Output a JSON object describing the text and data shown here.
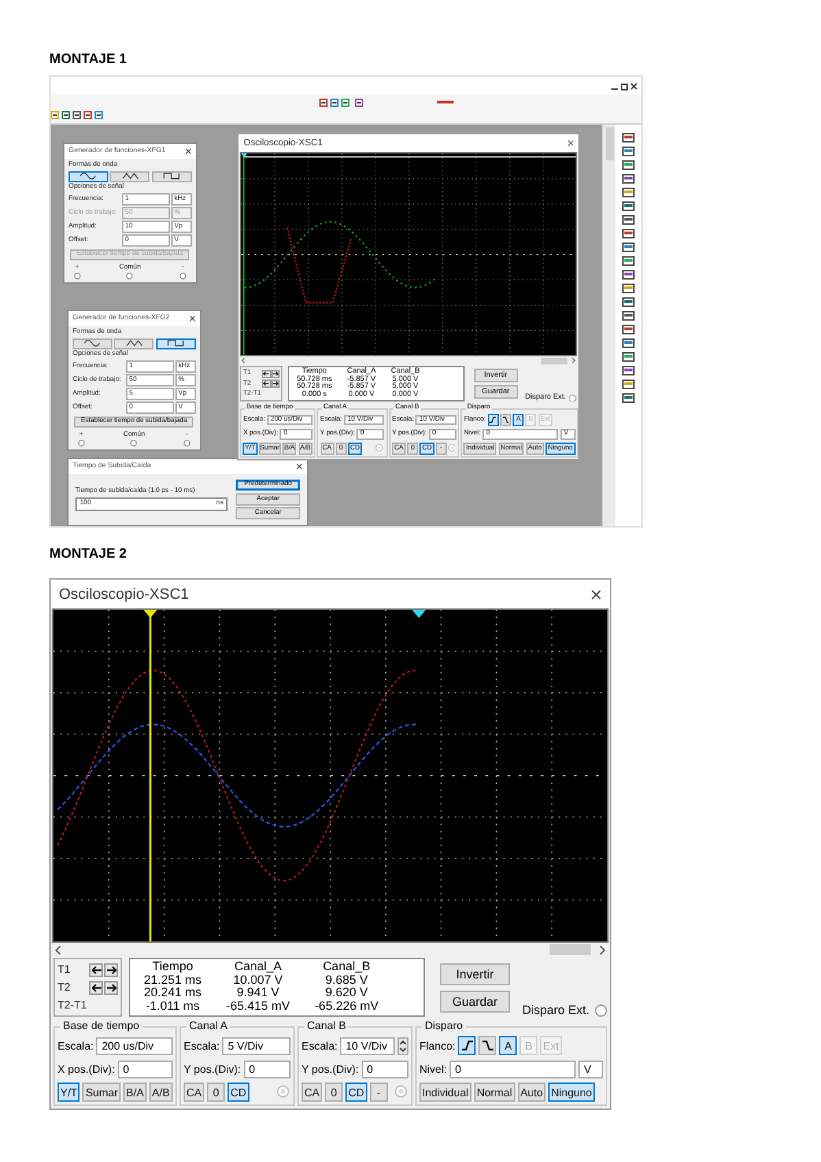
{
  "montaje_1": {
    "heading": "MONTAJE 1",
    "windows": [
      {
        "kind": "function_generator",
        "title": "Generador de funciones-XFG1",
        "waveform_label": "Formas de onda",
        "waveforms": [
          {
            "kind": "sine",
            "selected": true
          },
          {
            "kind": "triangle",
            "selected": false
          },
          {
            "kind": "square",
            "selected": false
          }
        ],
        "options_label": "Opciones de señal",
        "params": [
          {
            "label": "Frecuencia:",
            "value": "1",
            "unit": "kHz",
            "disabled": false
          },
          {
            "label": "Ciclo de trabajo:",
            "value": "50",
            "unit": "%",
            "disabled": true
          },
          {
            "label": "Amplitud:",
            "value": "10",
            "unit": "Vp",
            "disabled": false
          },
          {
            "label": "Offset:",
            "value": "0",
            "unit": "V",
            "disabled": false
          }
        ],
        "rise_button": {
          "label": "Establecer tiempo de subida/bajada",
          "disabled": true
        },
        "terminals": [
          "+",
          "Común",
          "-"
        ]
      },
      {
        "kind": "function_generator",
        "title": "Generador de funciones-XFG2",
        "waveform_label": "Formas de onda",
        "waveforms": [
          {
            "kind": "sine",
            "selected": false
          },
          {
            "kind": "triangle",
            "selected": false
          },
          {
            "kind": "square",
            "selected": true
          }
        ],
        "options_label": "Opciones de señal",
        "params": [
          {
            "label": "Frecuencia:",
            "value": "1",
            "unit": "kHz",
            "disabled": false
          },
          {
            "label": "Ciclo de trabajo:",
            "value": "50",
            "unit": "%",
            "disabled": false
          },
          {
            "label": "Amplitud:",
            "value": "5",
            "unit": "Vp",
            "disabled": false
          },
          {
            "label": "Offset:",
            "value": "0",
            "unit": "V",
            "disabled": false
          }
        ],
        "rise_button": {
          "label": "Establecer tiempo de subida/bajada",
          "disabled": false
        },
        "terminals": [
          "+",
          "Común",
          "-"
        ]
      },
      {
        "kind": "dialog",
        "title": "Tiempo de Subida/Caída",
        "field": {
          "label": "Tiempo de subida/caída (1.0 ps - 10 ms)",
          "value": "100",
          "unit": "ns"
        },
        "buttons": [
          {
            "label": "Predeterminado",
            "selected": true
          },
          {
            "label": "Aceptar",
            "selected": false
          },
          {
            "label": "Cancelar",
            "selected": false
          }
        ]
      },
      {
        "kind": "oscilloscope",
        "title": "Osciloscopio-XSC1",
        "readout": {
          "cursors": [
            {
              "label": "T1",
              "arrows": true
            },
            {
              "label": "T2",
              "arrows": true
            },
            {
              "label": "T2-T1",
              "arrows": false
            }
          ],
          "columns": [
            {
              "header": "Tiempo",
              "values": [
                "50.728 ms",
                "50.728 ms",
                "0.000 s"
              ]
            },
            {
              "header": "Canal_A",
              "values": [
                "-5.857 V",
                "-5.857 V",
                "0.000 V"
              ]
            },
            {
              "header": "Canal_B",
              "values": [
                "5.000 V",
                "5.000 V",
                "0.000 V"
              ]
            }
          ]
        },
        "buttons": [
          {
            "label": "Invertir"
          },
          {
            "label": "Guardar"
          }
        ],
        "ext_trigger": {
          "label": "Disparo Ext.",
          "selected": false
        },
        "groups": [
          {
            "title": "Base de tiempo",
            "terminal": false,
            "rows": [
              {
                "kind": "field",
                "label": "Escala:",
                "value": "200 us/Div"
              },
              {
                "kind": "field",
                "label": "X pos.(Div):",
                "value": "0"
              },
              {
                "kind": "buttons",
                "options": [
                  {
                    "kind": "text",
                    "label": "Y/T",
                    "selected": true
                  },
                  {
                    "kind": "text",
                    "label": "Sumar",
                    "selected": false
                  },
                  {
                    "kind": "text",
                    "label": "B/A",
                    "selected": false
                  },
                  {
                    "kind": "text",
                    "label": "A/B",
                    "selected": false
                  }
                ]
              }
            ]
          },
          {
            "title": "Canal A",
            "terminal": true,
            "rows": [
              {
                "kind": "field",
                "label": "Escala:",
                "value": "10 V/Div"
              },
              {
                "kind": "field",
                "label": "Y pos.(Div):",
                "value": "0"
              },
              {
                "kind": "buttons",
                "options": [
                  {
                    "kind": "text",
                    "label": "CA",
                    "selected": false
                  },
                  {
                    "kind": "text",
                    "label": "0",
                    "selected": false
                  },
                  {
                    "kind": "text",
                    "label": "CD",
                    "selected": true
                  }
                ]
              }
            ]
          },
          {
            "title": "Canal B",
            "terminal": true,
            "rows": [
              {
                "kind": "field",
                "label": "Escala:",
                "value": "10 V/Div"
              },
              {
                "kind": "field",
                "label": "Y pos.(Div):",
                "value": "0"
              },
              {
                "kind": "buttons",
                "options": [
                  {
                    "kind": "text",
                    "label": "CA",
                    "selected": false
                  },
                  {
                    "kind": "text",
                    "label": "0",
                    "selected": false
                  },
                  {
                    "kind": "text",
                    "label": "CD",
                    "selected": true
                  },
                  {
                    "kind": "text",
                    "label": "-",
                    "selected": false
                  }
                ]
              }
            ]
          },
          {
            "title": "Disparo",
            "terminal": false,
            "rows": [
              {
                "kind": "buttons",
                "label": "Flanco:",
                "options": [
                  {
                    "kind": "rising",
                    "selected": true,
                    "disabled": false
                  },
                  {
                    "kind": "falling",
                    "selected": false,
                    "disabled": false
                  },
                  {
                    "kind": "text",
                    "label": "A",
                    "selected": true,
                    "disabled": false
                  },
                  {
                    "kind": "text",
                    "label": "B",
                    "selected": false,
                    "disabled": true
                  },
                  {
                    "kind": "text",
                    "label": "Ext",
                    "selected": false,
                    "disabled": true
                  }
                ]
              },
              {
                "kind": "field",
                "label": "Nivel:",
                "value": "0",
                "unit": "V"
              },
              {
                "kind": "buttons",
                "options": [
                  {
                    "kind": "text",
                    "label": "Individual",
                    "selected": false
                  },
                  {
                    "kind": "text",
                    "label": "Normal",
                    "selected": false
                  },
                  {
                    "kind": "text",
                    "label": "Auto",
                    "selected": false
                  },
                  {
                    "kind": "text",
                    "label": "Ninguno",
                    "selected": true
                  }
                ]
              }
            ]
          }
        ]
      }
    ]
  },
  "montaje_2": {
    "heading": "MONTAJE 2",
    "oscilloscope": {
      "title": "Osciloscopio-XSC1",
      "readout": {
        "cursors": [
          {
            "label": "T1",
            "arrows": true
          },
          {
            "label": "T2",
            "arrows": true
          },
          {
            "label": "T2-T1",
            "arrows": false
          }
        ],
        "columns": [
          {
            "header": "Tiempo",
            "values": [
              "21.251 ms",
              "20.241 ms",
              "-1.011 ms"
            ]
          },
          {
            "header": "Canal_A",
            "values": [
              "10.007 V",
              "9.941 V",
              "-65.415 mV"
            ]
          },
          {
            "header": "Canal_B",
            "values": [
              "9.685 V",
              "9.620 V",
              "-65.226 mV"
            ]
          }
        ]
      },
      "buttons": [
        {
          "label": "Invertir"
        },
        {
          "label": "Guardar"
        }
      ],
      "ext_trigger": {
        "label": "Disparo Ext.",
        "selected": false
      },
      "groups": [
        {
          "title": "Base de tiempo",
          "terminal": false,
          "rows": [
            {
              "kind": "field",
              "label": "Escala:",
              "value": "200 us/Div"
            },
            {
              "kind": "field",
              "label": "X pos.(Div):",
              "value": "0"
            },
            {
              "kind": "buttons",
              "options": [
                {
                  "kind": "text",
                  "label": "Y/T",
                  "selected": true
                },
                {
                  "kind": "text",
                  "label": "Sumar",
                  "selected": false
                },
                {
                  "kind": "text",
                  "label": "B/A",
                  "selected": false
                },
                {
                  "kind": "text",
                  "label": "A/B",
                  "selected": false
                }
              ]
            }
          ]
        },
        {
          "title": "Canal A",
          "terminal": true,
          "rows": [
            {
              "kind": "field",
              "label": "Escala:",
              "value": "5  V/Div"
            },
            {
              "kind": "field",
              "label": "Y pos.(Div):",
              "value": "0"
            },
            {
              "kind": "buttons",
              "options": [
                {
                  "kind": "text",
                  "label": "CA",
                  "selected": false
                },
                {
                  "kind": "text",
                  "label": "0",
                  "selected": false
                },
                {
                  "kind": "text",
                  "label": "CD",
                  "selected": true
                }
              ]
            }
          ]
        },
        {
          "title": "Canal B",
          "terminal": true,
          "rows": [
            {
              "kind": "field",
              "label": "Escala:",
              "value": "10  V/Div",
              "spinner": true
            },
            {
              "kind": "field",
              "label": "Y pos.(Div):",
              "value": "0"
            },
            {
              "kind": "buttons",
              "options": [
                {
                  "kind": "text",
                  "label": "CA",
                  "selected": false
                },
                {
                  "kind": "text",
                  "label": "0",
                  "selected": false
                },
                {
                  "kind": "text",
                  "label": "CD",
                  "selected": true
                },
                {
                  "kind": "text",
                  "label": "-",
                  "selected": false
                }
              ]
            }
          ]
        },
        {
          "title": "Disparo",
          "terminal": false,
          "rows": [
            {
              "kind": "buttons",
              "label": "Flanco:",
              "options": [
                {
                  "kind": "rising",
                  "selected": true,
                  "disabled": false
                },
                {
                  "kind": "falling",
                  "selected": false,
                  "disabled": false
                },
                {
                  "kind": "text",
                  "label": "A",
                  "selected": true,
                  "disabled": false
                },
                {
                  "kind": "text",
                  "label": "B",
                  "selected": false,
                  "disabled": true
                },
                {
                  "kind": "text",
                  "label": "Ext",
                  "selected": false,
                  "disabled": true
                }
              ]
            },
            {
              "kind": "field",
              "label": "Nivel:",
              "value": "0",
              "unit": "V"
            },
            {
              "kind": "buttons",
              "options": [
                {
                  "kind": "text",
                  "label": "Individual",
                  "selected": false
                },
                {
                  "kind": "text",
                  "label": "Normal",
                  "selected": false
                },
                {
                  "kind": "text",
                  "label": "Auto",
                  "selected": false
                },
                {
                  "kind": "text",
                  "label": "Ninguno",
                  "selected": true
                }
              ]
            }
          ]
        }
      ]
    }
  }
}
